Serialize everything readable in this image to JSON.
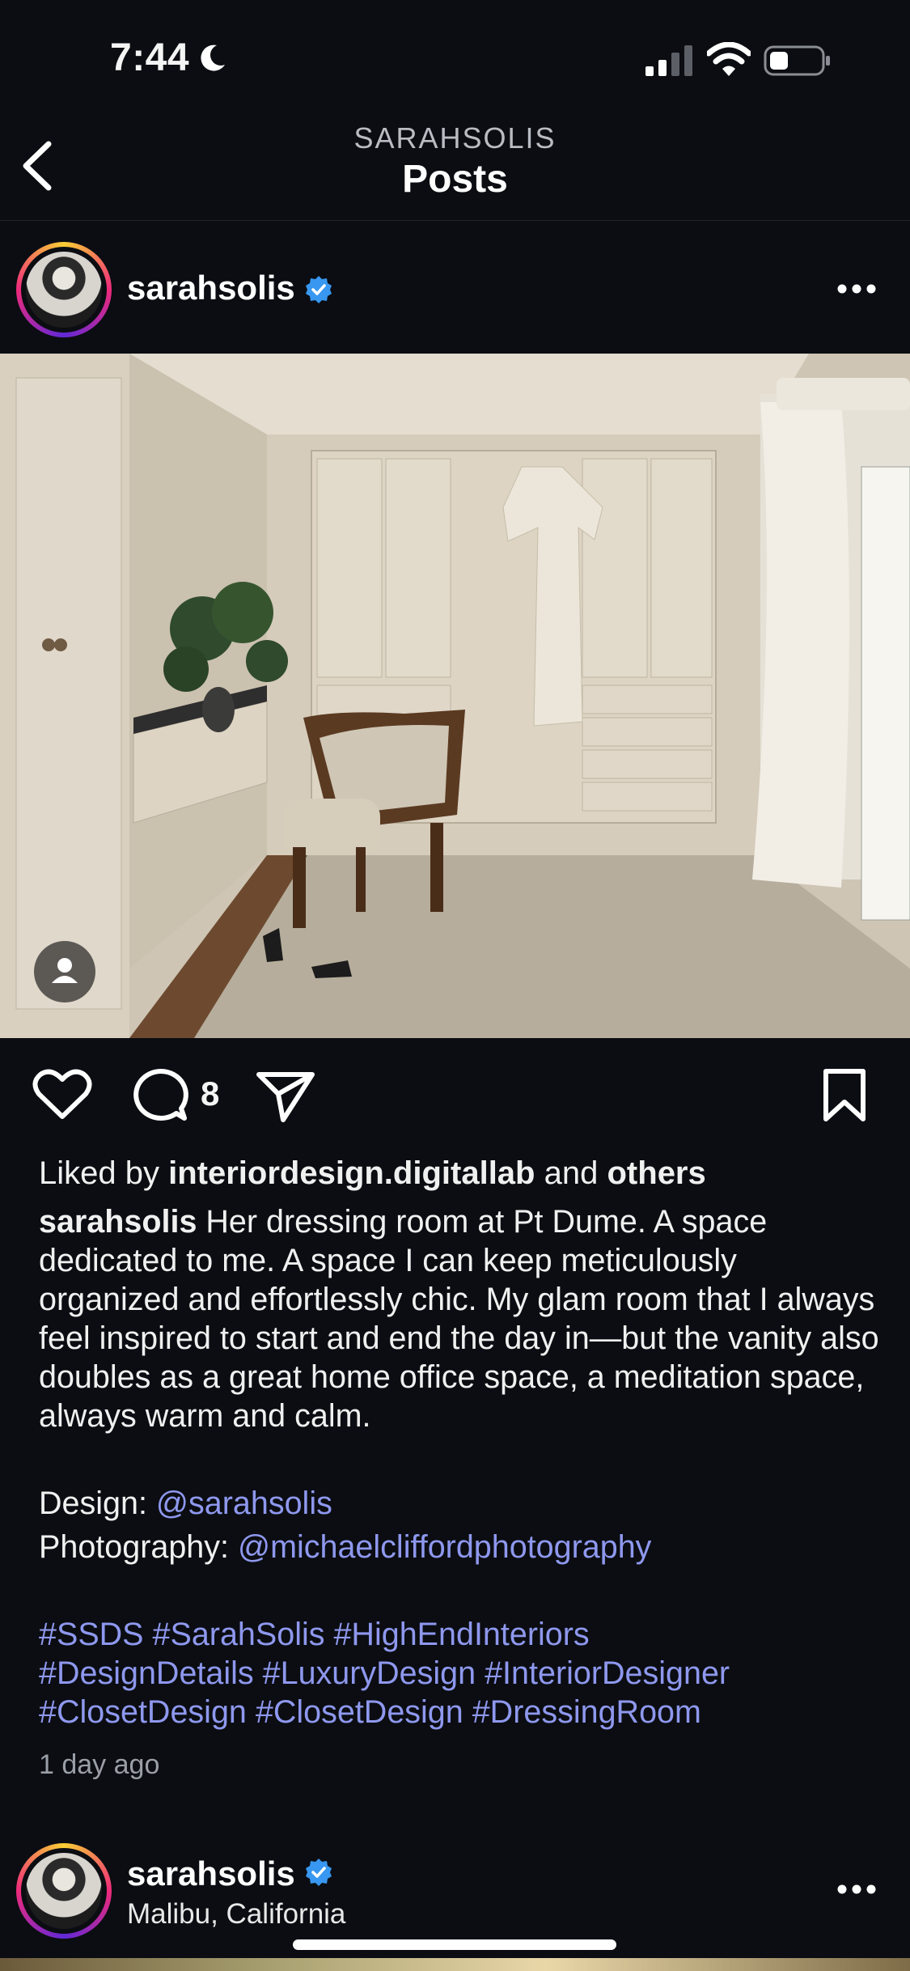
{
  "status_bar": {
    "time": "7:44"
  },
  "header": {
    "subtitle": "SARAHSOLIS",
    "title": "Posts"
  },
  "post": {
    "username": "sarahsolis",
    "comment_count": "8",
    "liked_prefix": "Liked by",
    "liked_user": "interiordesign.digitallab",
    "liked_and": "and",
    "liked_others": "others",
    "caption_user": "sarahsolis",
    "caption_text": "Her dressing room at Pt Dume. A space dedicated to me. A space I can keep meticulously organized and effortlessly chic. My glam room that I always feel inspired to start and end the day in—but the vanity also doubles as a great home office space, a meditation space, always warm and calm.",
    "design_label": "Design:",
    "design_handle": "@sarahsolis",
    "photo_label": "Photography:",
    "photo_handle": "@michaelcliffordphotography",
    "hashtags_line1": "#SSDS #SarahSolis #HighEndInteriors",
    "hashtags_line2": "#DesignDetails #LuxuryDesign #InteriorDesigner",
    "hashtags_line3": "#ClosetDesign #ClosetDesign #DressingRoom",
    "time_ago": "1 day ago"
  },
  "next_post": {
    "username": "sarahsolis",
    "location": "Malibu, California"
  },
  "colors": {
    "background": "#0b0d12",
    "link": "#8e98ee",
    "verified": "#3897f0"
  }
}
